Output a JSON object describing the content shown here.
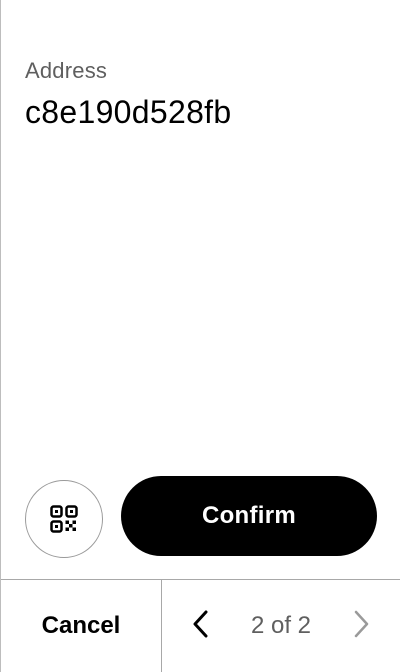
{
  "address": {
    "label": "Address",
    "value": "c8e190d528fb"
  },
  "actions": {
    "qr_icon": "qr-code-icon",
    "confirm_label": "Confirm"
  },
  "footer": {
    "cancel_label": "Cancel",
    "prev_icon": "chevron-left-icon",
    "next_icon": "chevron-right-icon",
    "page_indicator": "2 of 2",
    "current_page": 2,
    "total_pages": 2
  },
  "colors": {
    "primary_button_bg": "#000000",
    "primary_button_text": "#ffffff",
    "secondary_text": "#5f5f5f",
    "border": "#a8a8a8",
    "disabled_icon": "#9a9a9a"
  }
}
